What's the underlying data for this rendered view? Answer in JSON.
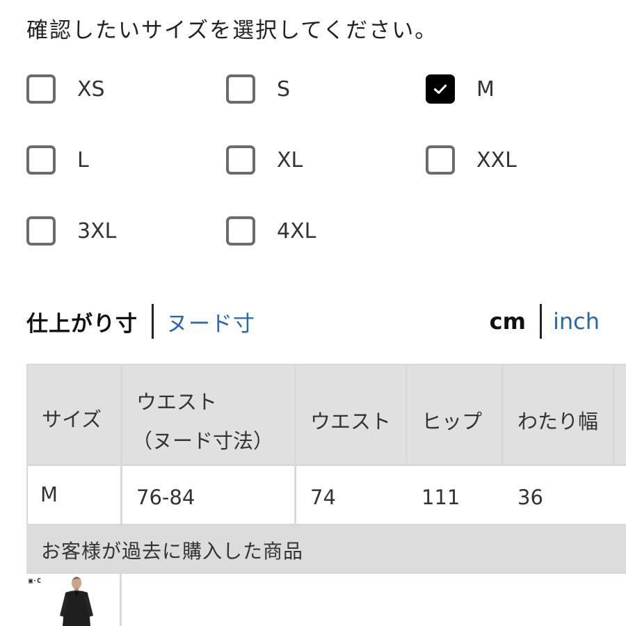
{
  "prompt": "確認したいサイズを選択してください。",
  "sizes": [
    {
      "label": "XS",
      "checked": false
    },
    {
      "label": "S",
      "checked": false
    },
    {
      "label": "M",
      "checked": true
    },
    {
      "label": "L",
      "checked": false
    },
    {
      "label": "XL",
      "checked": false
    },
    {
      "label": "XXL",
      "checked": false
    },
    {
      "label": "3XL",
      "checked": false
    },
    {
      "label": "4XL",
      "checked": false
    }
  ],
  "measure_toggle": {
    "active": "仕上がり寸",
    "link": "ヌード寸"
  },
  "unit_toggle": {
    "active": "cm",
    "link": "inch"
  },
  "table": {
    "headers": {
      "size": "サイズ",
      "waist_nude_line1": "ウエスト",
      "waist_nude_line2": "（ヌード寸法）",
      "waist": "ウエスト",
      "hip": "ヒップ",
      "thigh": "わたり幅"
    },
    "row": {
      "size": "M",
      "waist_nude": "76-84",
      "waist": "74",
      "hip": "111",
      "thigh": "36"
    }
  },
  "purchased_label": "お客様が過去に購入した商品",
  "brand_mark": "▣·C",
  "colors": {
    "link": "#2a67a8",
    "checkbox_border": "#6b6b6b",
    "checkbox_checked": "#000000",
    "table_header_bg": "#e0e0e0"
  },
  "icons": {
    "checkbox_checked": "checkmark-icon"
  }
}
